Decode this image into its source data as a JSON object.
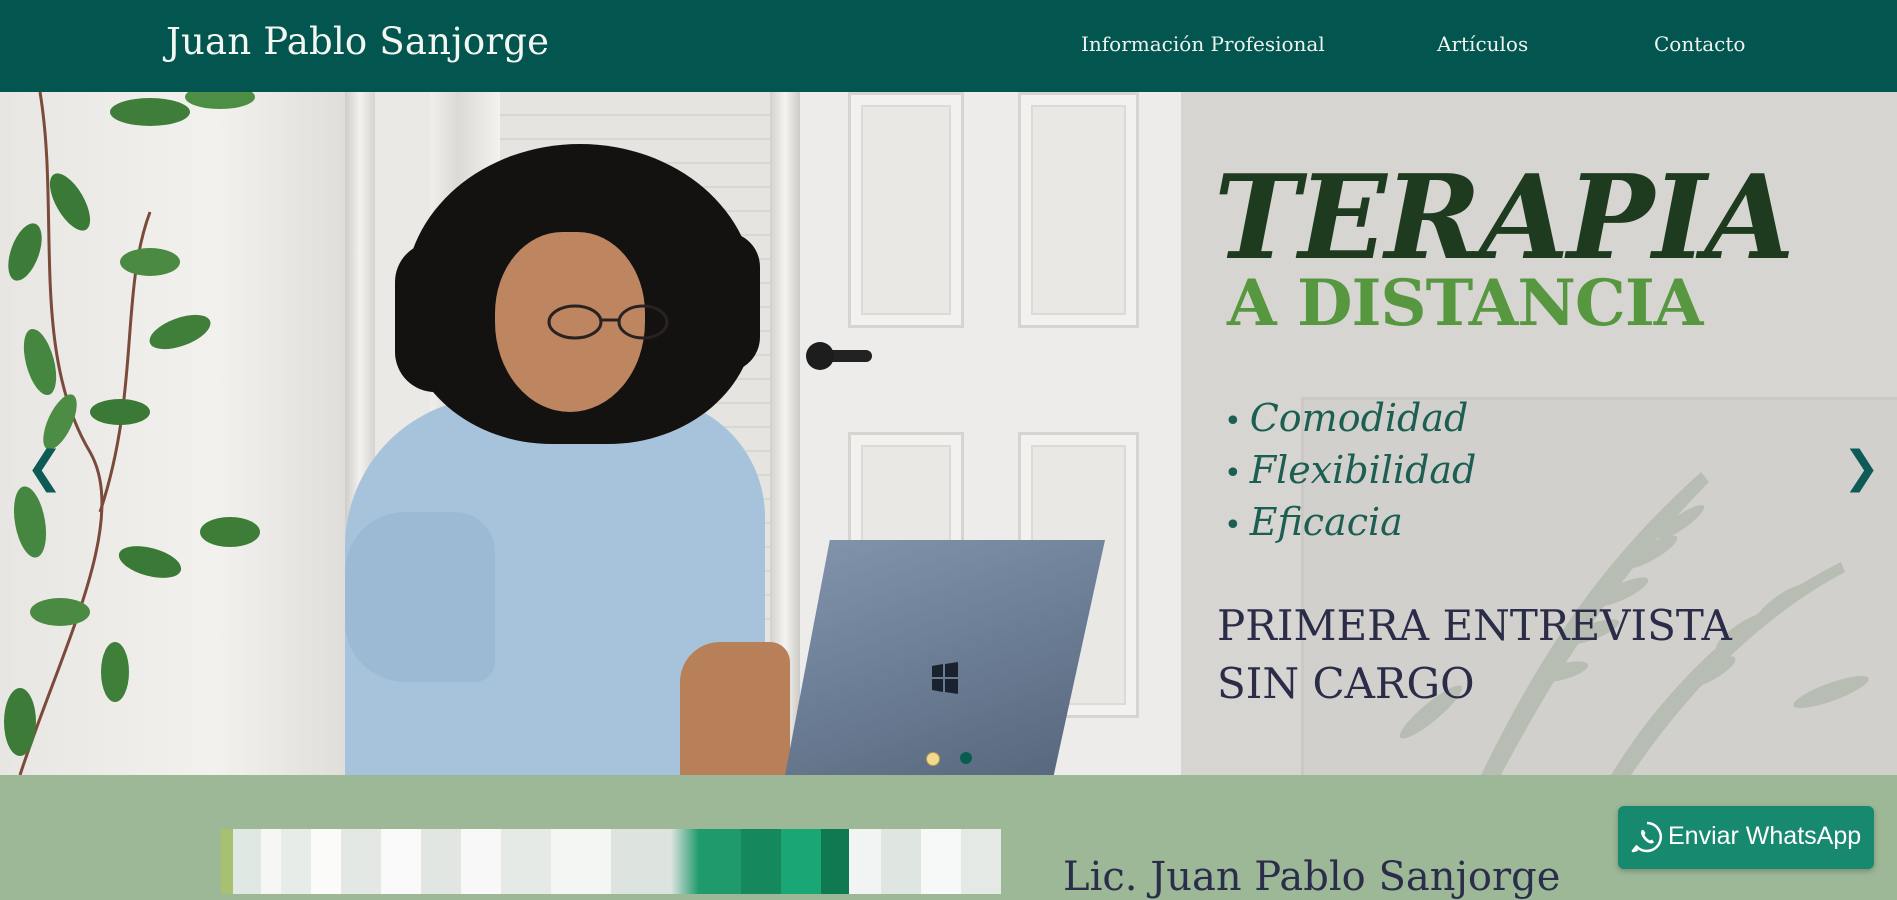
{
  "header": {
    "brand": "Juan Pablo Sanjorge",
    "nav": [
      {
        "label": "Información Profesional"
      },
      {
        "label": "Artículos"
      },
      {
        "label": "Contacto"
      }
    ]
  },
  "hero": {
    "title_line1": "TERAPIA",
    "title_line2": "A DISTANCIA",
    "bullets": [
      "Comodidad",
      "Flexibilidad",
      "Eficacia"
    ],
    "bullet_glyph": "•",
    "offer_line1": "PRIMERA ENTREVISTA",
    "offer_line2": "SIN CARGO",
    "prev_glyph": "❮",
    "next_glyph": "❯",
    "slide_count": 2,
    "active_slide": 1
  },
  "about": {
    "title": "Lic. Juan Pablo Sanjorge"
  },
  "whatsapp": {
    "label": "Enviar WhatsApp",
    "icon": "whatsapp-icon"
  },
  "colors": {
    "header_bg": "#035650",
    "section_bg": "#9db897",
    "title_dark_green": "#1f3b1f",
    "title_light_green": "#579740",
    "bullet_color": "#1c5e52",
    "offer_color": "#2a2c48",
    "whatsapp_bg": "#17896f",
    "dot_active": "#f3d98b",
    "dot_inactive": "#0a5c52"
  }
}
